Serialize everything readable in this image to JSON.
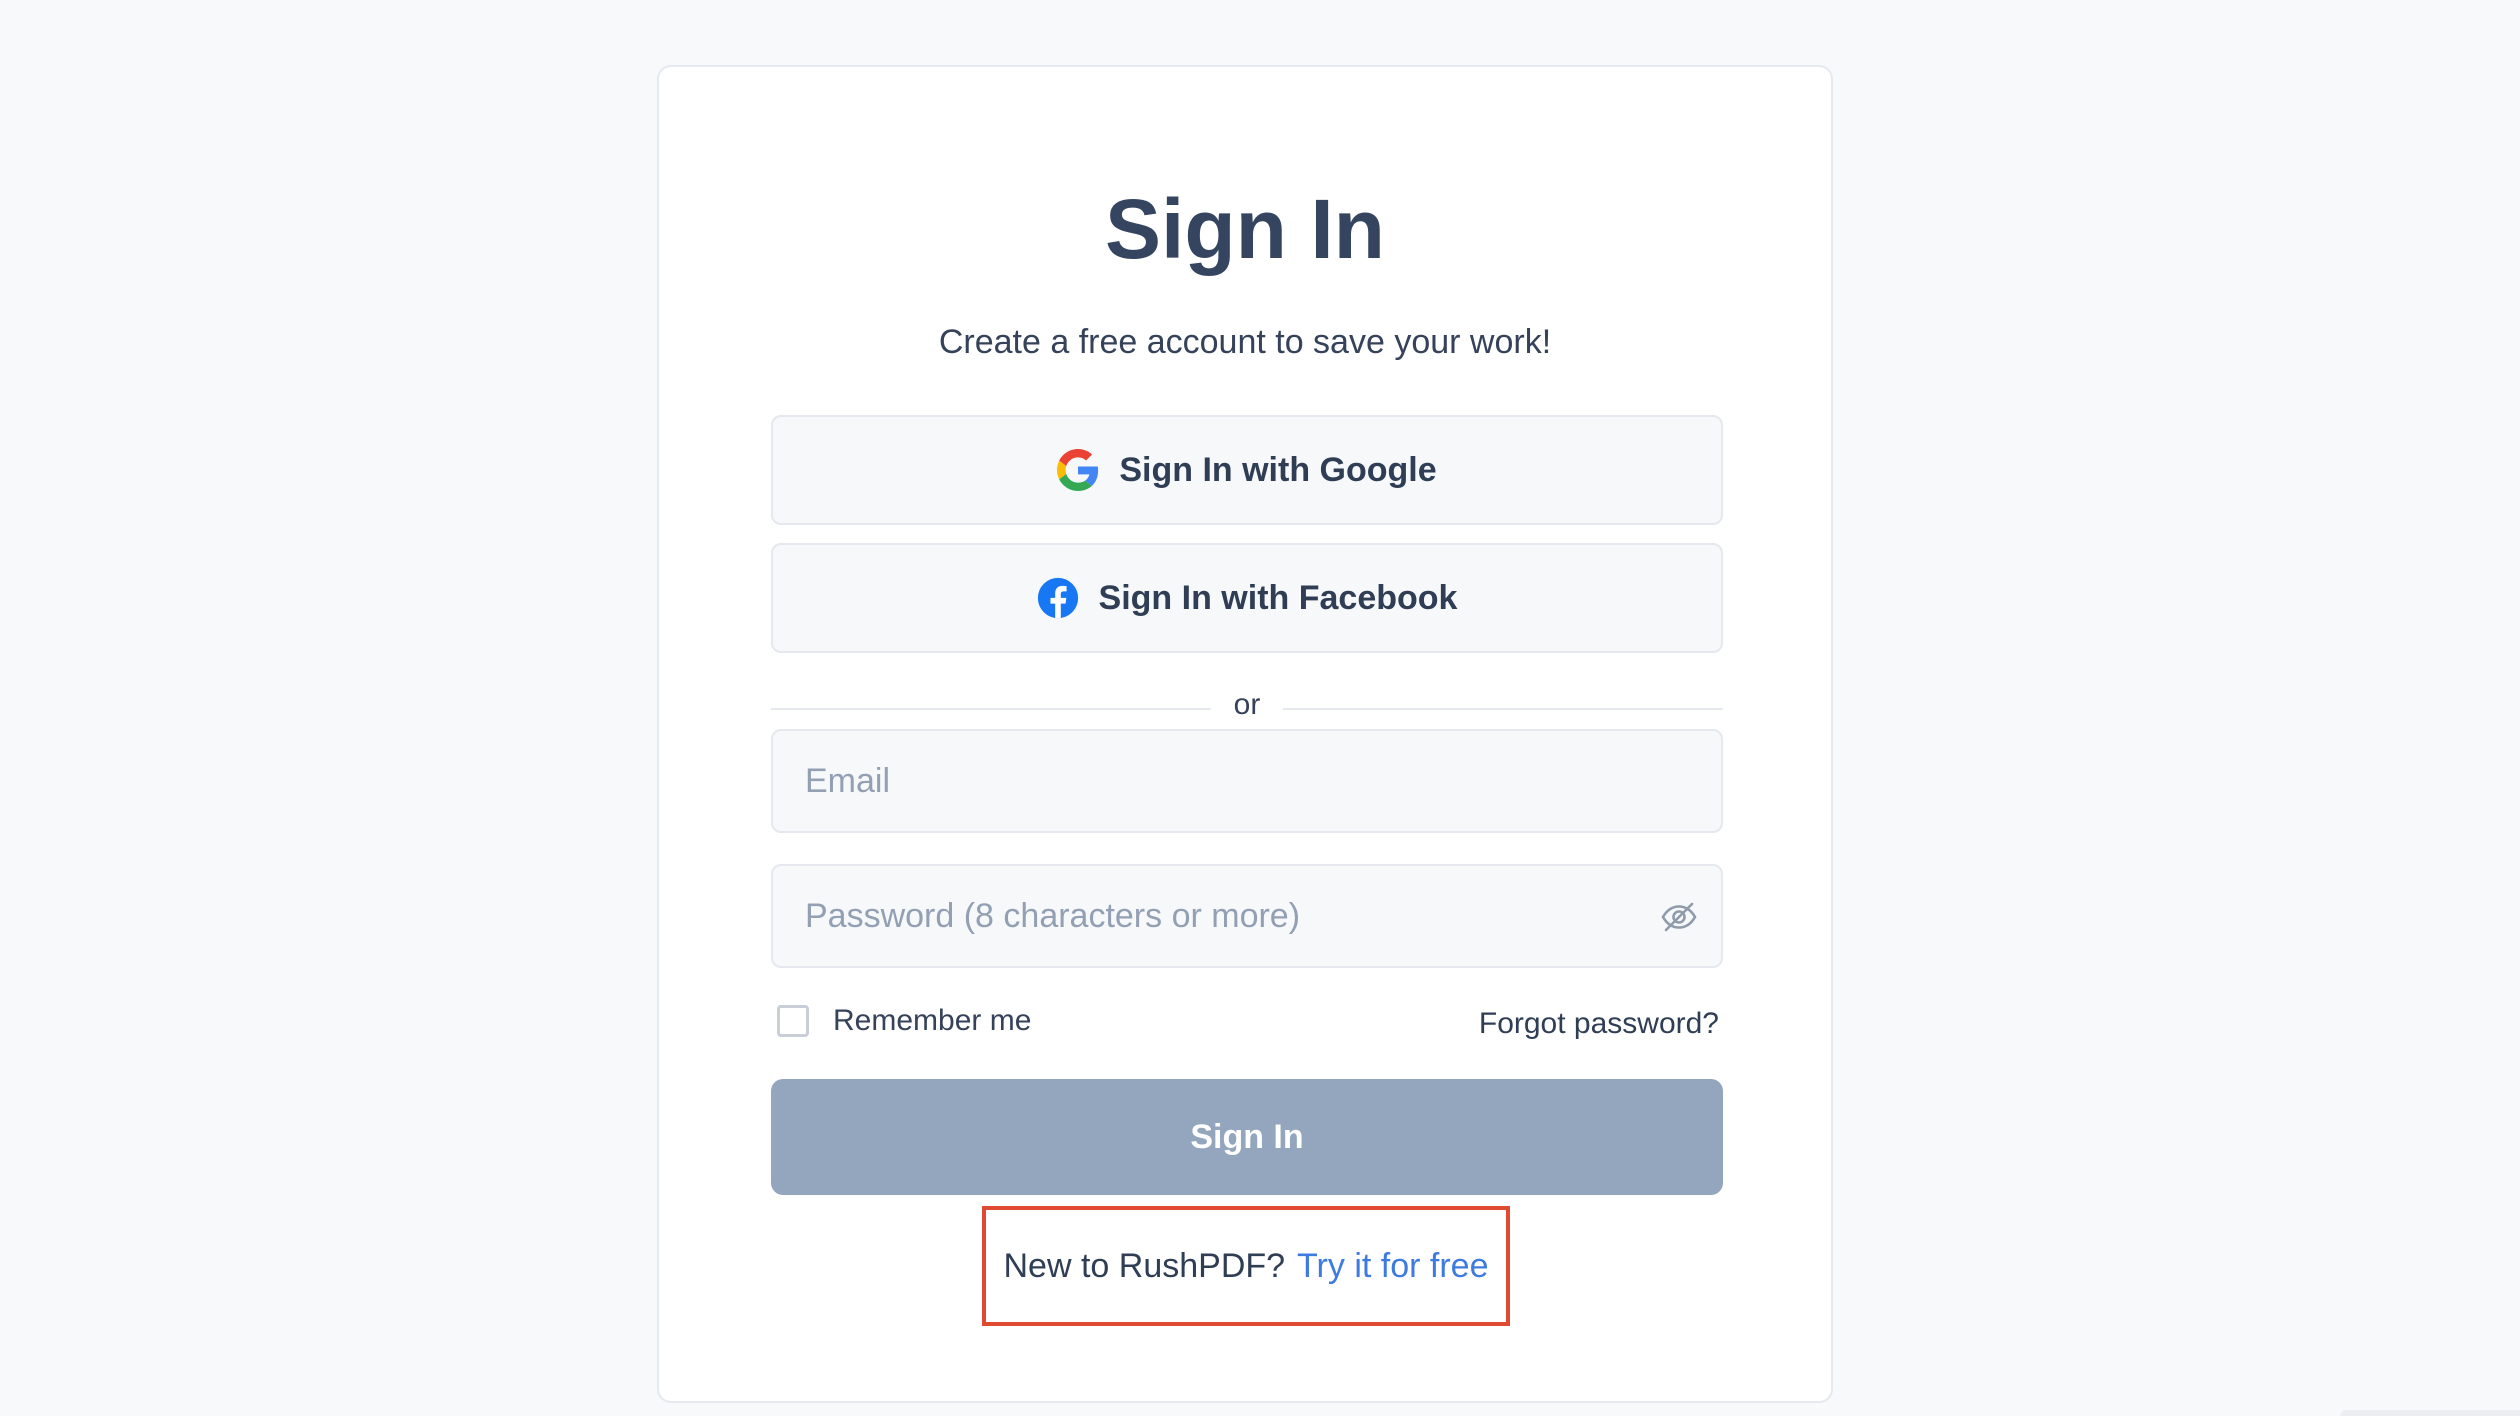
{
  "page": {
    "title": "Sign In",
    "subtitle": "Create a free account to save your work!"
  },
  "social": {
    "google_label": "Sign In with Google",
    "facebook_label": "Sign In with Facebook"
  },
  "divider": {
    "text": "or"
  },
  "form": {
    "email_placeholder": "Email",
    "password_placeholder": "Password (8 characters or more)",
    "remember_label": "Remember me",
    "remember_checked": false,
    "forgot_label": "Forgot password?",
    "submit_label": "Sign In"
  },
  "footer": {
    "prompt_text": "New to RushPDF?",
    "link_text": "Try it for free"
  },
  "colors": {
    "primary_button": "#94a6bd",
    "link": "#3d7be0",
    "highlight_box": "#de4a32",
    "heading": "#354560"
  },
  "icons": {
    "google": "google-icon",
    "facebook": "facebook-icon",
    "password_toggle": "eye-slash-icon"
  }
}
